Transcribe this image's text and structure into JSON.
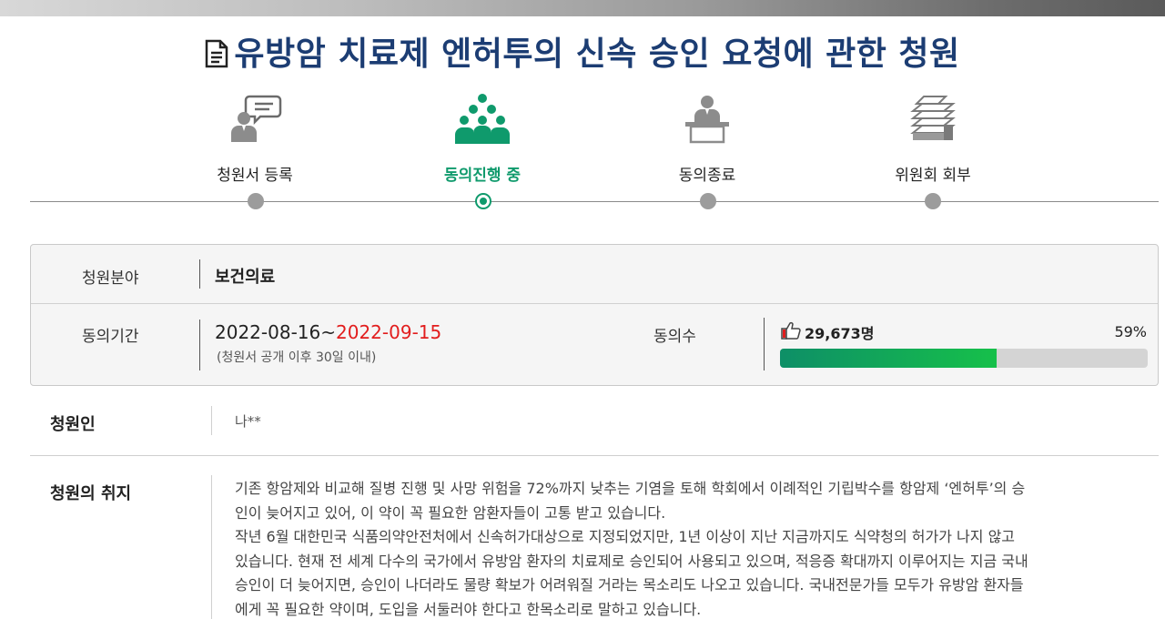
{
  "title": "유방암 치료제 엔허투의 신속 승인 요청에 관한 청원",
  "steps": [
    {
      "label": "청원서 등록",
      "icon": "speech-person-icon",
      "active": false
    },
    {
      "label": "동의진행 중",
      "icon": "people-group-icon",
      "active": true
    },
    {
      "label": "동의종료",
      "icon": "podium-person-icon",
      "active": false
    },
    {
      "label": "위원회 회부",
      "icon": "document-stack-icon",
      "active": false
    }
  ],
  "info": {
    "field_label": "청원분야",
    "field_value": "보건의료",
    "period_label": "동의기간",
    "period_start": "2022-08-16~",
    "period_end": "2022-09-15",
    "period_note": "(청원서 공개 이후 30일 이내)",
    "agree_label": "동의수",
    "agree_count": "29,673명",
    "agree_percent": "59%",
    "agree_progress": 0.59
  },
  "petitioner": {
    "label": "청원인",
    "value": "나**"
  },
  "purpose": {
    "label": "청원의 취지",
    "lines": [
      "기존 항암제와 비교해 질병 진행 및 사망 위험을 72%까지 낮추는 기염을 토해 학회에서 이례적인 기립박수를 항암제 ‘엔허투’의 승",
      "인이 늦어지고 있어, 이 약이 꼭 필요한 암환자들이 고통 받고 있습니다.",
      "작년 6월 대한민국 식품의약안전처에서 신속허가대상으로 지정되었지만, 1년 이상이 지난 지금까지도 식약청의 허가가 나지 않고",
      "있습니다. 현재 전 세계 다수의 국가에서 유방암 환자의 치료제로 승인되어 사용되고 있으며, 적응증 확대까지 이루어지는 지금 국내",
      "승인이 더 늦어지면, 승인이 나더라도 물량 확보가 어려워질 거라는 목소리도 나오고 있습니다. 국내전문가들 모두가 유방암 환자들",
      "에게 꼭 필요한 약이며, 도입을 서둘러야 한다고 한목소리로 말하고 있습니다."
    ]
  },
  "colors": {
    "title": "#1c3d73",
    "active": "#0f9a6c",
    "end_date": "#e21d1d"
  }
}
